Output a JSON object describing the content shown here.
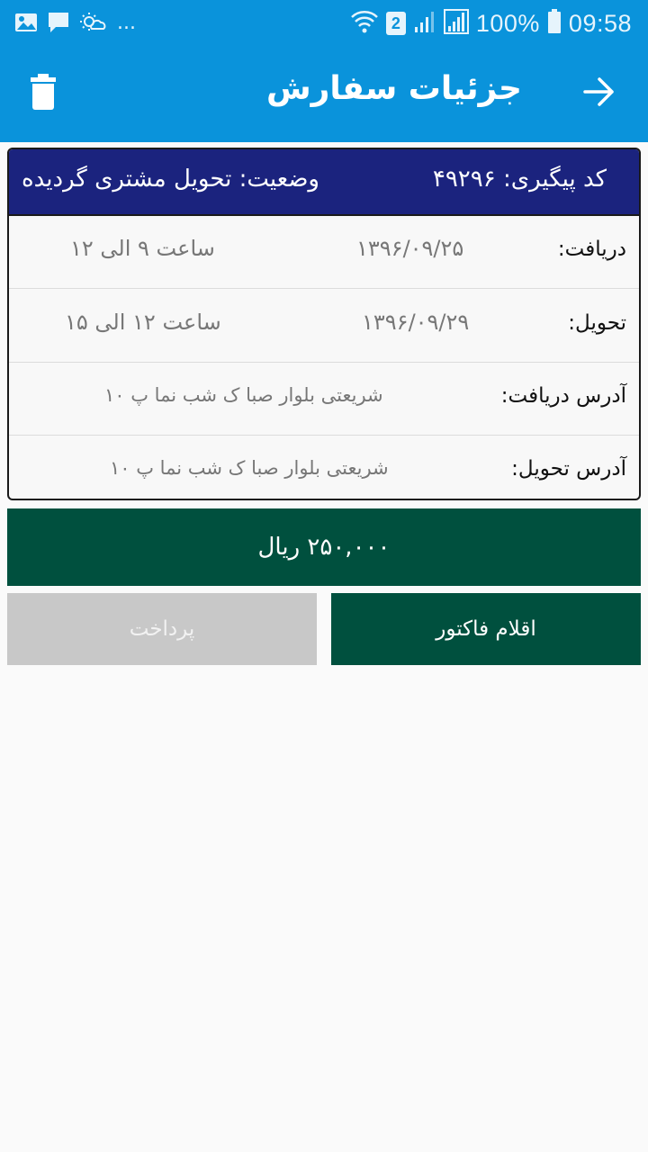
{
  "status_bar": {
    "time": "09:58",
    "battery": "100%",
    "sim_badge": "2",
    "more": "...",
    "icons": [
      "image-icon",
      "message-icon",
      "weather-icon",
      "wifi-icon",
      "sim-icon",
      "signal-icon",
      "signal-icon",
      "battery-icon"
    ]
  },
  "app_bar": {
    "title": "جزئیات سفارش",
    "back_icon": "arrow-right-icon",
    "delete_icon": "trash-icon"
  },
  "order": {
    "tracking_code": "کد پیگیری: ۴۹۲۹۶",
    "status": "وضعیت: تحویل مشتری گردیده",
    "pickup_label": "دریافت:",
    "pickup_date": "۱۳۹۶/۰۹/۲۵",
    "pickup_time": "ساعت ۹ الی ۱۲",
    "delivery_label": "تحویل:",
    "delivery_date": "۱۳۹۶/۰۹/۲۹",
    "delivery_time": "ساعت ۱۲ الی ۱۵",
    "pickup_address_label": "آدرس دریافت:",
    "pickup_address": "شریعتی بلوار صبا ک شب نما پ ۱۰",
    "delivery_address_label": "آدرس تحویل:",
    "delivery_address": "شریعتی بلوار صبا ک شب نما پ ۱۰"
  },
  "price": "۲۵۰,۰۰۰ ریال",
  "buttons": {
    "invoice_items": "اقلام فاکتور",
    "pay": "پرداخت"
  },
  "colors": {
    "primary": "#0a93db",
    "header": "#1b237e",
    "accent": "#00503e",
    "disabled": "#c8c8c8"
  }
}
